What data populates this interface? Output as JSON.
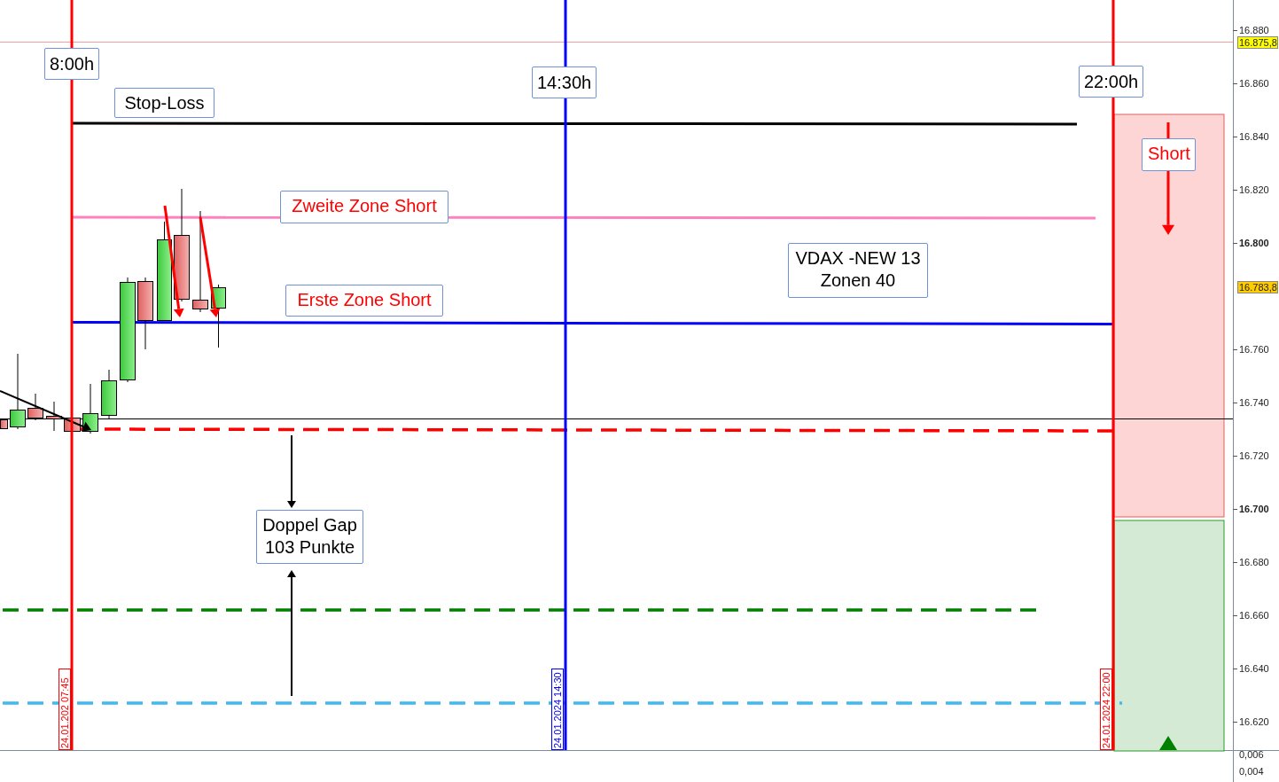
{
  "time_markers": [
    {
      "label": "8:00h",
      "date_label": "24.01.202 07:45",
      "color": "#ff0000"
    },
    {
      "label": "14:30h",
      "date_label": "24.01.2024 14:30",
      "color": "#0000ff"
    },
    {
      "label": "22:00h",
      "date_label": "24.01.2024 22:00",
      "color": "#ff0000"
    }
  ],
  "annotations": [
    {
      "text": "Stop-Loss",
      "color": "#000000"
    },
    {
      "text": "Zweite Zone Short",
      "color": "#ff0000"
    },
    {
      "text": "Erste Zone Short",
      "color": "#ff0000"
    },
    {
      "text": "VDAX -NEW 13\nZonen 40",
      "color": "#000000"
    },
    {
      "text": "Doppel Gap\n103 Punkte",
      "color": "#000000"
    },
    {
      "text": "Short",
      "color": "#ff0000"
    }
  ],
  "price_axis": {
    "ticks": [
      {
        "label": "16.880",
        "major": false
      },
      {
        "label": "16.860",
        "major": false
      },
      {
        "label": "16.840",
        "major": false
      },
      {
        "label": "16.820",
        "major": false
      },
      {
        "label": "16.800",
        "major": true
      },
      {
        "label": "16.760",
        "major": false
      },
      {
        "label": "16.740",
        "major": false
      },
      {
        "label": "16.720",
        "major": false
      },
      {
        "label": "16.700",
        "major": true
      },
      {
        "label": "16.680",
        "major": false
      },
      {
        "label": "16.660",
        "major": false
      },
      {
        "label": "16.640",
        "major": false
      },
      {
        "label": "16.620",
        "major": false
      }
    ],
    "markers": [
      {
        "label": "16.875,8",
        "color": "#ffff00"
      },
      {
        "label": "16.783,8",
        "color": "#ffcc00"
      }
    ]
  },
  "indicator_axis": {
    "ticks": [
      "0,006",
      "0,004"
    ]
  }
}
